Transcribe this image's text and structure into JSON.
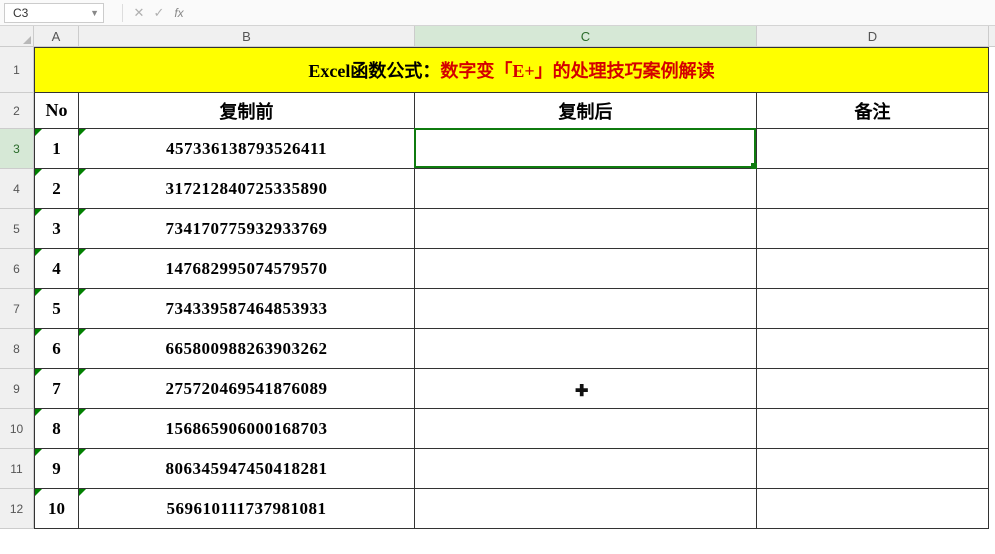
{
  "formula_bar": {
    "name_box_value": "C3",
    "cancel_glyph": "✕",
    "enter_glyph": "✓",
    "fx_label": "fx",
    "formula_value": ""
  },
  "column_headers": {
    "A": "A",
    "B": "B",
    "C": "C",
    "D": "D"
  },
  "row_heights": {
    "header_row": 46,
    "head2_row": 36,
    "data_row": 40
  },
  "title": {
    "part1": "Excel函数公式：",
    "part2": "数字变「E+」的处理技巧案例解读"
  },
  "headers": {
    "no": "No",
    "before_copy": "复制前",
    "after_copy": "复制后",
    "remark": "备注"
  },
  "rows": [
    {
      "no": "1",
      "before": "457336138793526411",
      "after": "",
      "remark": ""
    },
    {
      "no": "2",
      "before": "317212840725335890",
      "after": "",
      "remark": ""
    },
    {
      "no": "3",
      "before": "734170775932933769",
      "after": "",
      "remark": ""
    },
    {
      "no": "4",
      "before": "147682995074579570",
      "after": "",
      "remark": ""
    },
    {
      "no": "5",
      "before": "734339587464853933",
      "after": "",
      "remark": ""
    },
    {
      "no": "6",
      "before": "665800988263903262",
      "after": "",
      "remark": ""
    },
    {
      "no": "7",
      "before": "275720469541876089",
      "after": "",
      "remark": ""
    },
    {
      "no": "8",
      "before": "156865906000168703",
      "after": "",
      "remark": ""
    },
    {
      "no": "9",
      "before": "806345947450418281",
      "after": "",
      "remark": ""
    },
    {
      "no": "10",
      "before": "569610111737981081",
      "after": "",
      "remark": ""
    }
  ],
  "active_cell": "C3",
  "active_column": "C",
  "active_row_index": 3
}
